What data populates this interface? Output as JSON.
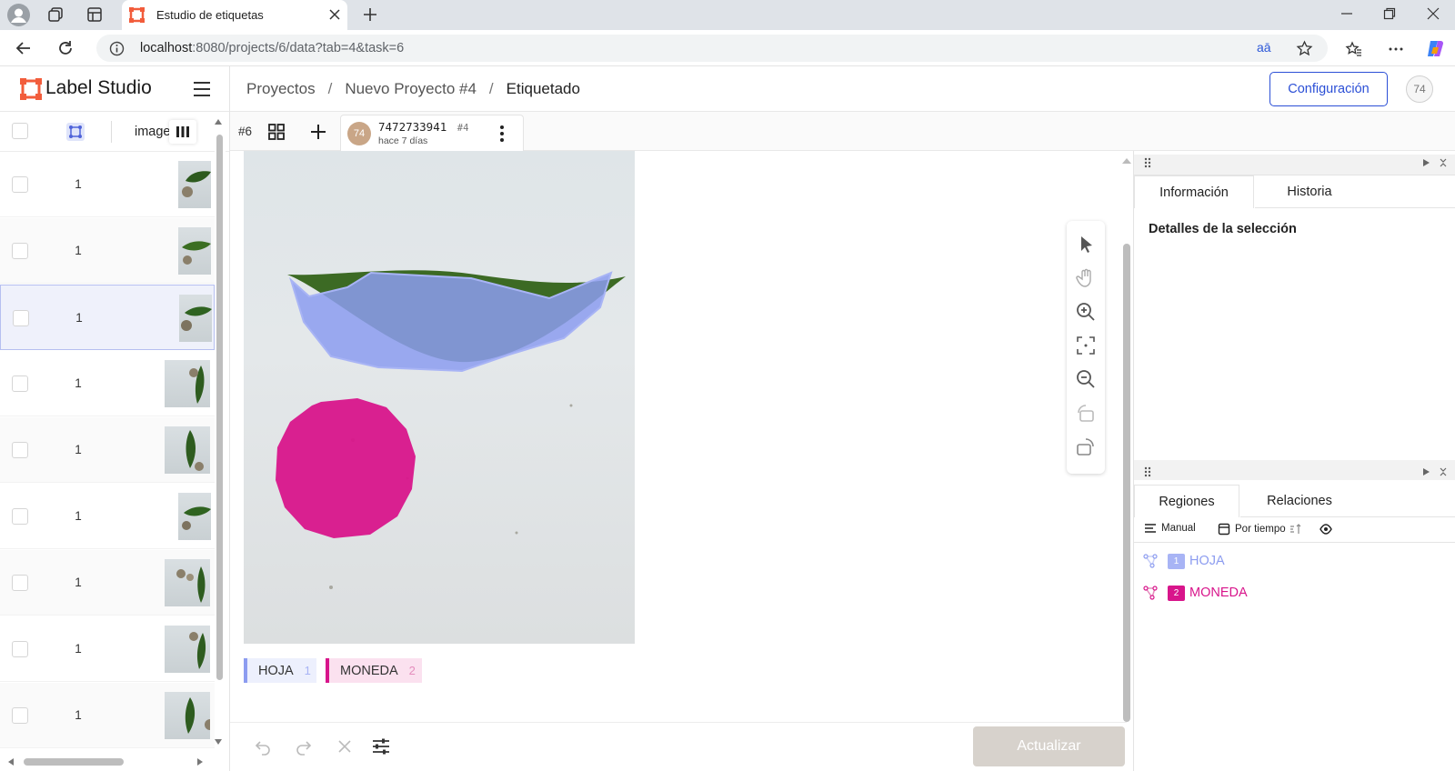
{
  "browser": {
    "tab_title": "Estudio de etiquetas",
    "url_host": "localhost",
    "url_rest": ":8080/projects/6/data?tab=4&task=6",
    "translate_glyph": "aā"
  },
  "app": {
    "logo_text": "Label Studio",
    "breadcrumbs": [
      "Proyectos",
      "Nuevo Proyecto #4",
      "Etiquetado"
    ],
    "config_label": "Configuración",
    "user_initials": "74"
  },
  "task_list": {
    "column_header": "image",
    "rows": [
      {
        "count": "1"
      },
      {
        "count": "1"
      },
      {
        "count": "1"
      },
      {
        "count": "1"
      },
      {
        "count": "1"
      },
      {
        "count": "1"
      },
      {
        "count": "1"
      },
      {
        "count": "1"
      },
      {
        "count": "1"
      }
    ]
  },
  "annotation": {
    "task_number": "#6",
    "annotation_id": "7472733941",
    "annotation_number": "#4",
    "time_ago": "hace 7 días",
    "author_initials": "74"
  },
  "labels": [
    {
      "name": "HOJA",
      "hotkey": "1",
      "color": "#8c9cf0"
    },
    {
      "name": "MONEDA",
      "hotkey": "2",
      "color": "#d8158b"
    }
  ],
  "update_label": "Actualizar",
  "info_panel": {
    "tabs": [
      "Información",
      "Historia"
    ],
    "selection_title": "Detalles de la selección"
  },
  "regions_panel": {
    "tabs": [
      "Regiones",
      "Relaciones"
    ],
    "sort_manual": "Manual",
    "sort_time": "Por tiempo",
    "regions": [
      {
        "index": "1",
        "name": "HOJA",
        "color": "#8c9cf0"
      },
      {
        "index": "2",
        "name": "MONEDA",
        "color": "#d8158b"
      }
    ]
  }
}
